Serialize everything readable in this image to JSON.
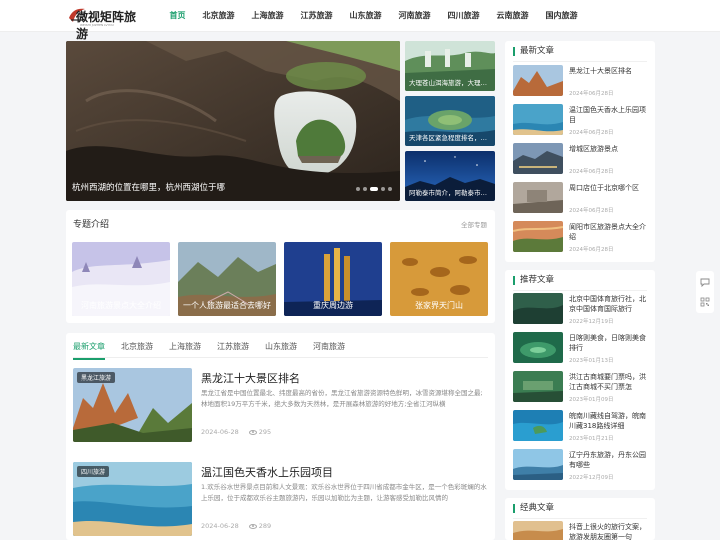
{
  "header": {
    "logo_text": "微视矩阵旅游",
    "logo_sub": "WEISHI JUZHEN LVYOU",
    "nav": [
      "首页",
      "北京旅游",
      "上海旅游",
      "江苏旅游",
      "山东旅游",
      "河南旅游",
      "四川旅游",
      "云南旅游",
      "国内旅游"
    ],
    "active_nav": 0
  },
  "hero": {
    "main_caption": "杭州西湖的位置在哪里，杭州西湖位于哪",
    "side": [
      {
        "caption": "大理苍山洱海旅游，大理苍山洱海旅游攻略"
      },
      {
        "caption": "天津各区紧急程度排名，天津各区排名"
      },
      {
        "caption": "阿勒泰市简介，阿勒泰市简介是"
      }
    ]
  },
  "topics": {
    "title": "专题介绍",
    "more": "全部专题",
    "items": [
      {
        "label": "河南旅游景点大全介绍"
      },
      {
        "label": "一个人旅游最适合去哪好"
      },
      {
        "label": "重庆周边游"
      },
      {
        "label": "张家界天门山"
      }
    ]
  },
  "articles": {
    "tabs": [
      "最新文章",
      "北京旅游",
      "上海旅游",
      "江苏旅游",
      "山东旅游",
      "河南旅游"
    ],
    "active_tab": 0,
    "items": [
      {
        "badge": "黑龙江旅游",
        "title": "黑龙江十大景区排名",
        "desc": "黑龙江省是中国位置最北、纬度最高的省份，黑龙江省旅游资源特色鲜明，冰雪资源堪称全国之最;林地面积19万平方千米，绝大多数为天然林，是开展森林旅游的好地方;全省江河纵横",
        "date": "2024-06-28",
        "views": "295"
      },
      {
        "badge": "四川旅游",
        "title": "温江国色天香水上乐园项目",
        "desc": "1.欢乐谷水世界景点目前和人文景观：欢乐谷水世界位于四川省成都市金牛区，是一个色彩斑斓的水上乐园，位于成都欢乐谷主题旅游内，乐园以加勒比为主题，让游客感受加勒比风情的",
        "date": "2024-06-28",
        "views": "289"
      }
    ]
  },
  "sidebar": {
    "latest": {
      "title": "最新文章",
      "items": [
        {
          "title": "黑龙江十大景区排名",
          "date": "2024年06月28日"
        },
        {
          "title": "温江国色天香水上乐园项目",
          "date": "2024年06月28日"
        },
        {
          "title": "增城区旅游景点",
          "date": "2024年06月28日"
        },
        {
          "title": "周口店位于北京哪个区",
          "date": "2024年06月28日"
        },
        {
          "title": "阆阳市区旅游景点大全介绍",
          "date": "2024年06月28日"
        }
      ]
    },
    "recommended": {
      "title": "推荐文章",
      "items": [
        {
          "title": "北京中国体育旅行社，北京中国体育国际旅行",
          "date": "2022年12月19日"
        },
        {
          "title": "日喀则美食，日喀则美食排行",
          "date": "2023年01月13日"
        },
        {
          "title": "洪江古商城要门票吗，洪江古商城不买门票怎",
          "date": "2023年01月09日"
        },
        {
          "title": "皖南川藏线自驾游，皖南川藏318路线详细",
          "date": "2023年01月21日"
        },
        {
          "title": "辽宁丹东旅游，丹东公园有哪些",
          "date": "2022年12月09日"
        }
      ]
    },
    "classic": {
      "title": "经典文章",
      "items": [
        {
          "title": "抖音上很火的旅行文案，旅游发朋友圈第一句",
          "date": ""
        }
      ]
    }
  },
  "colors": {
    "accent": "#1a9e6c"
  },
  "icons": {
    "float_tools": [
      "chat-icon",
      "qrcode-icon"
    ]
  }
}
